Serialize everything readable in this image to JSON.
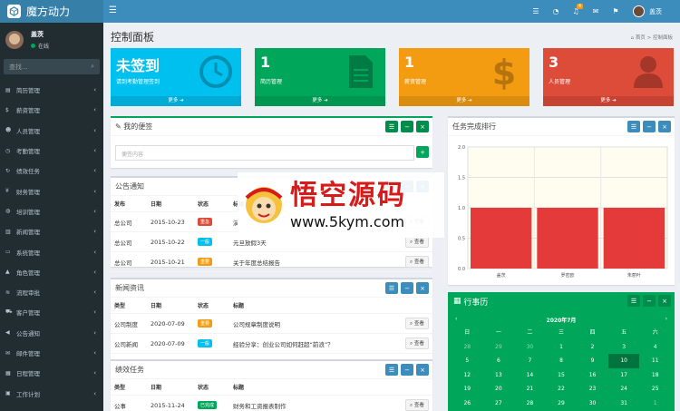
{
  "app": {
    "title": "魔方动力"
  },
  "topbar": {
    "badge": "4",
    "user": "盖茨"
  },
  "sidebar": {
    "user_name": "盖茨",
    "user_status": "在线",
    "search_placeholder": "查找...",
    "items": [
      {
        "label": "简历管理",
        "icon": "file-icon"
      },
      {
        "label": "薪资管理",
        "icon": "dollar-icon"
      },
      {
        "label": "人员管理",
        "icon": "user-icon"
      },
      {
        "label": "考勤管理",
        "icon": "clock-icon"
      },
      {
        "label": "绩效任务",
        "icon": "refresh-icon"
      },
      {
        "label": "财务管理",
        "icon": "money-icon"
      },
      {
        "label": "培训管理",
        "icon": "globe-icon"
      },
      {
        "label": "新闻管理",
        "icon": "news-icon"
      },
      {
        "label": "系统管理",
        "icon": "desktop-icon"
      },
      {
        "label": "角色管理",
        "icon": "graduation-icon"
      },
      {
        "label": "流程审批",
        "icon": "flow-icon"
      },
      {
        "label": "客户管理",
        "icon": "cart-icon"
      },
      {
        "label": "公告通知",
        "icon": "bullhorn-icon"
      },
      {
        "label": "邮件管理",
        "icon": "mail-icon"
      },
      {
        "label": "日程管理",
        "icon": "calendar-icon"
      },
      {
        "label": "工作计划",
        "icon": "briefcase-icon"
      },
      {
        "label": "文档管理",
        "icon": "folder-icon"
      }
    ]
  },
  "page": {
    "title": "控制面板",
    "crumb_home": "首页",
    "crumb_current": "控制面板"
  },
  "stats": [
    {
      "value": "未签到",
      "label": "请到考勤管理签到",
      "more": "更多",
      "color": "#00c0ef"
    },
    {
      "value": "1",
      "label": "简历管理",
      "more": "更多",
      "color": "#00a65a"
    },
    {
      "value": "1",
      "label": "薪资管理",
      "more": "更多",
      "color": "#f39c12"
    },
    {
      "value": "3",
      "label": "人员管理",
      "more": "更多",
      "color": "#dd4b39"
    }
  ],
  "memo": {
    "title": "我的便签",
    "placeholder": "便签内容"
  },
  "notice": {
    "title": "公告通知",
    "headers": [
      "发布",
      "日期",
      "状态",
      "标题"
    ],
    "rows": [
      {
        "pub": "总公司",
        "date": "2015-10-23",
        "status": "重急",
        "status_color": "#dd4b39",
        "title": "演",
        "view": "查看"
      },
      {
        "pub": "总公司",
        "date": "2015-10-22",
        "status": "一般",
        "status_color": "#00c0ef",
        "title": "元旦放假3天",
        "view": "查看"
      },
      {
        "pub": "总公司",
        "date": "2015-10-21",
        "status": "重要",
        "status_color": "#f39c12",
        "title": "关于年度总结报告",
        "view": "查看"
      }
    ]
  },
  "news": {
    "title": "新闻资讯",
    "headers": [
      "类型",
      "日期",
      "状态",
      "标题"
    ],
    "rows": [
      {
        "type": "公司制度",
        "date": "2020-07-09",
        "status": "重要",
        "status_color": "#f39c12",
        "title": "公司规章制度说明",
        "view": "查看"
      },
      {
        "type": "公司新闻",
        "date": "2020-07-09",
        "status": "一般",
        "status_color": "#00c0ef",
        "title": "经验分享：创业公司如何赶超“前浪”？",
        "view": "查看"
      }
    ]
  },
  "perf": {
    "title": "绩效任务",
    "headers": [
      "类型",
      "日期",
      "状态",
      "标题"
    ],
    "rows": [
      {
        "type": "公事",
        "date": "2015-11-24",
        "status": "已完成",
        "status_color": "#00a65a",
        "title": "财务和工资报表制作",
        "view": "查看"
      }
    ]
  },
  "chart_data": {
    "type": "bar",
    "title": "任务完成排行",
    "categories": [
      "盖茨",
      "罗密欧",
      "朱丽叶"
    ],
    "values": [
      1.0,
      1.0,
      1.0
    ],
    "ylim": [
      0,
      2.0
    ],
    "yticks": [
      "2.0",
      "1.5",
      "1.0",
      "0.5",
      "0.0"
    ],
    "bar_color": "#e53a3a",
    "bg_color": "#fffdf0"
  },
  "calendar": {
    "title": "行事历",
    "month": "2020年7月",
    "weekdays": [
      "日",
      "一",
      "二",
      "三",
      "四",
      "五",
      "六"
    ],
    "days": [
      {
        "d": "28",
        "dim": true
      },
      {
        "d": "29",
        "dim": true
      },
      {
        "d": "30",
        "dim": true
      },
      {
        "d": "1"
      },
      {
        "d": "2"
      },
      {
        "d": "3"
      },
      {
        "d": "4"
      },
      {
        "d": "5"
      },
      {
        "d": "6"
      },
      {
        "d": "7"
      },
      {
        "d": "8"
      },
      {
        "d": "9"
      },
      {
        "d": "10",
        "today": true
      },
      {
        "d": "11"
      },
      {
        "d": "12"
      },
      {
        "d": "13"
      },
      {
        "d": "14"
      },
      {
        "d": "15"
      },
      {
        "d": "16"
      },
      {
        "d": "17"
      },
      {
        "d": "18"
      },
      {
        "d": "19"
      },
      {
        "d": "20"
      },
      {
        "d": "21"
      },
      {
        "d": "22"
      },
      {
        "d": "23"
      },
      {
        "d": "24"
      },
      {
        "d": "25"
      },
      {
        "d": "26"
      },
      {
        "d": "27"
      },
      {
        "d": "28"
      },
      {
        "d": "29"
      },
      {
        "d": "30"
      },
      {
        "d": "31"
      },
      {
        "d": "1",
        "dim": true
      }
    ]
  },
  "watermark": {
    "cn": "悟空源码",
    "url": "www.5kym.com"
  }
}
